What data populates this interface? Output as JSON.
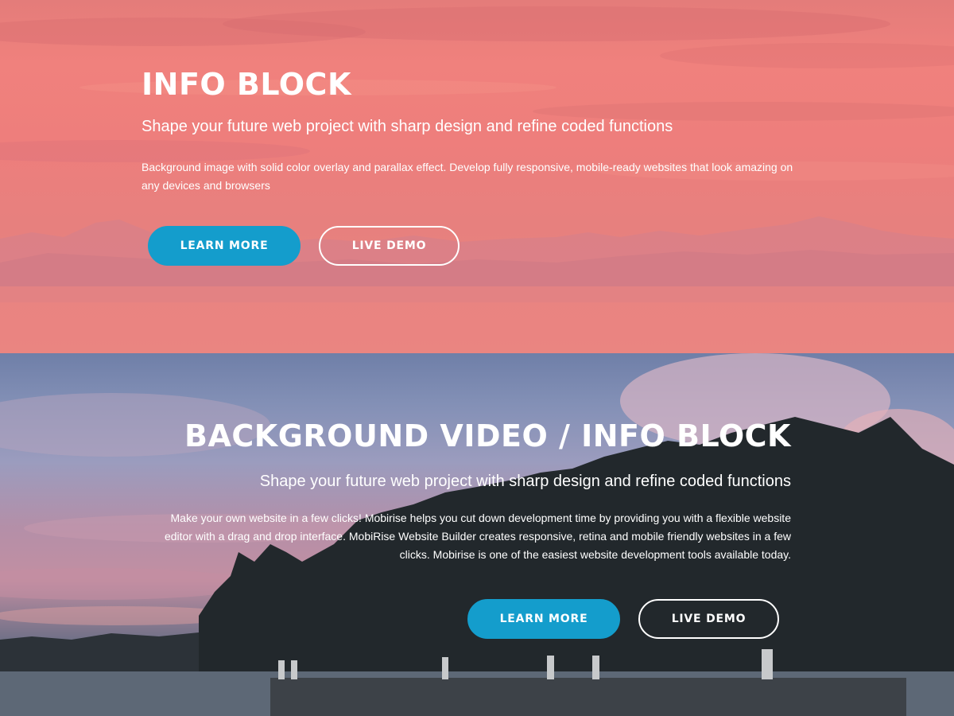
{
  "info_block": {
    "title": "INFO BLOCK",
    "subtitle": "Shape your future web project with sharp design and refine coded functions",
    "body": "Background image with solid color overlay and parallax effect. Develop fully responsive, mobile-ready websites that look amazing on any devices and browsers",
    "primary_button": "LEARN MORE",
    "secondary_button": "LIVE DEMO",
    "overlay_color": "#ef7f7c"
  },
  "video_block": {
    "title": "BACKGROUND VIDEO / INFO BLOCK",
    "subtitle": "Shape your future web project with sharp design and refine coded functions",
    "body": "Make your own website in a few clicks! Mobirise helps you cut down development time by providing you with a flexible website editor with a drag and drop interface. MobiRise Website Builder creates responsive, retina and mobile friendly websites in a few clicks. Mobirise is one of the easiest website development tools available today.",
    "primary_button": "LEARN MORE",
    "secondary_button": "LIVE DEMO"
  },
  "colors": {
    "accent": "#149dcc",
    "text": "#ffffff"
  }
}
